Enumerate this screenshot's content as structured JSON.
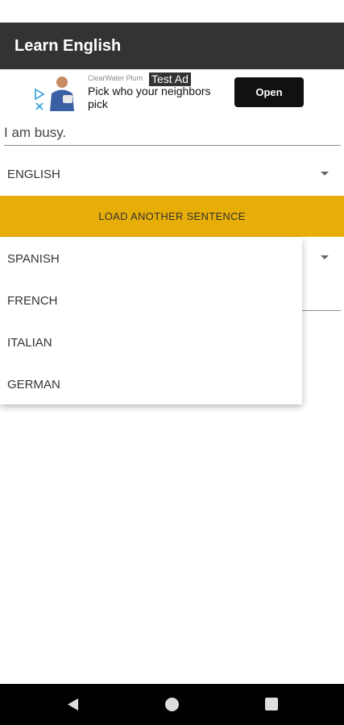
{
  "app_bar": {
    "title": "Learn English"
  },
  "ad": {
    "brand": "ClearWater Plum",
    "headline": "Pick who your neighbors pick",
    "test_label": "Test Ad",
    "open_label": "Open",
    "icons": [
      "ad-choices-icon",
      "advertiser-photo"
    ]
  },
  "sentence": {
    "value": "I am busy."
  },
  "source_language": {
    "selected": "ENGLISH"
  },
  "load_button": {
    "label": "LOAD ANOTHER SENTENCE"
  },
  "dropdown": {
    "items": [
      "SPANISH",
      "FRENCH",
      "ITALIAN",
      "GERMAN"
    ]
  },
  "nav_bar": {
    "icons": [
      "back-icon",
      "home-icon",
      "recents-icon"
    ]
  },
  "colors": {
    "app_bar": "#333333",
    "accent": "#e8ae08",
    "nav_bar": "#000000"
  }
}
